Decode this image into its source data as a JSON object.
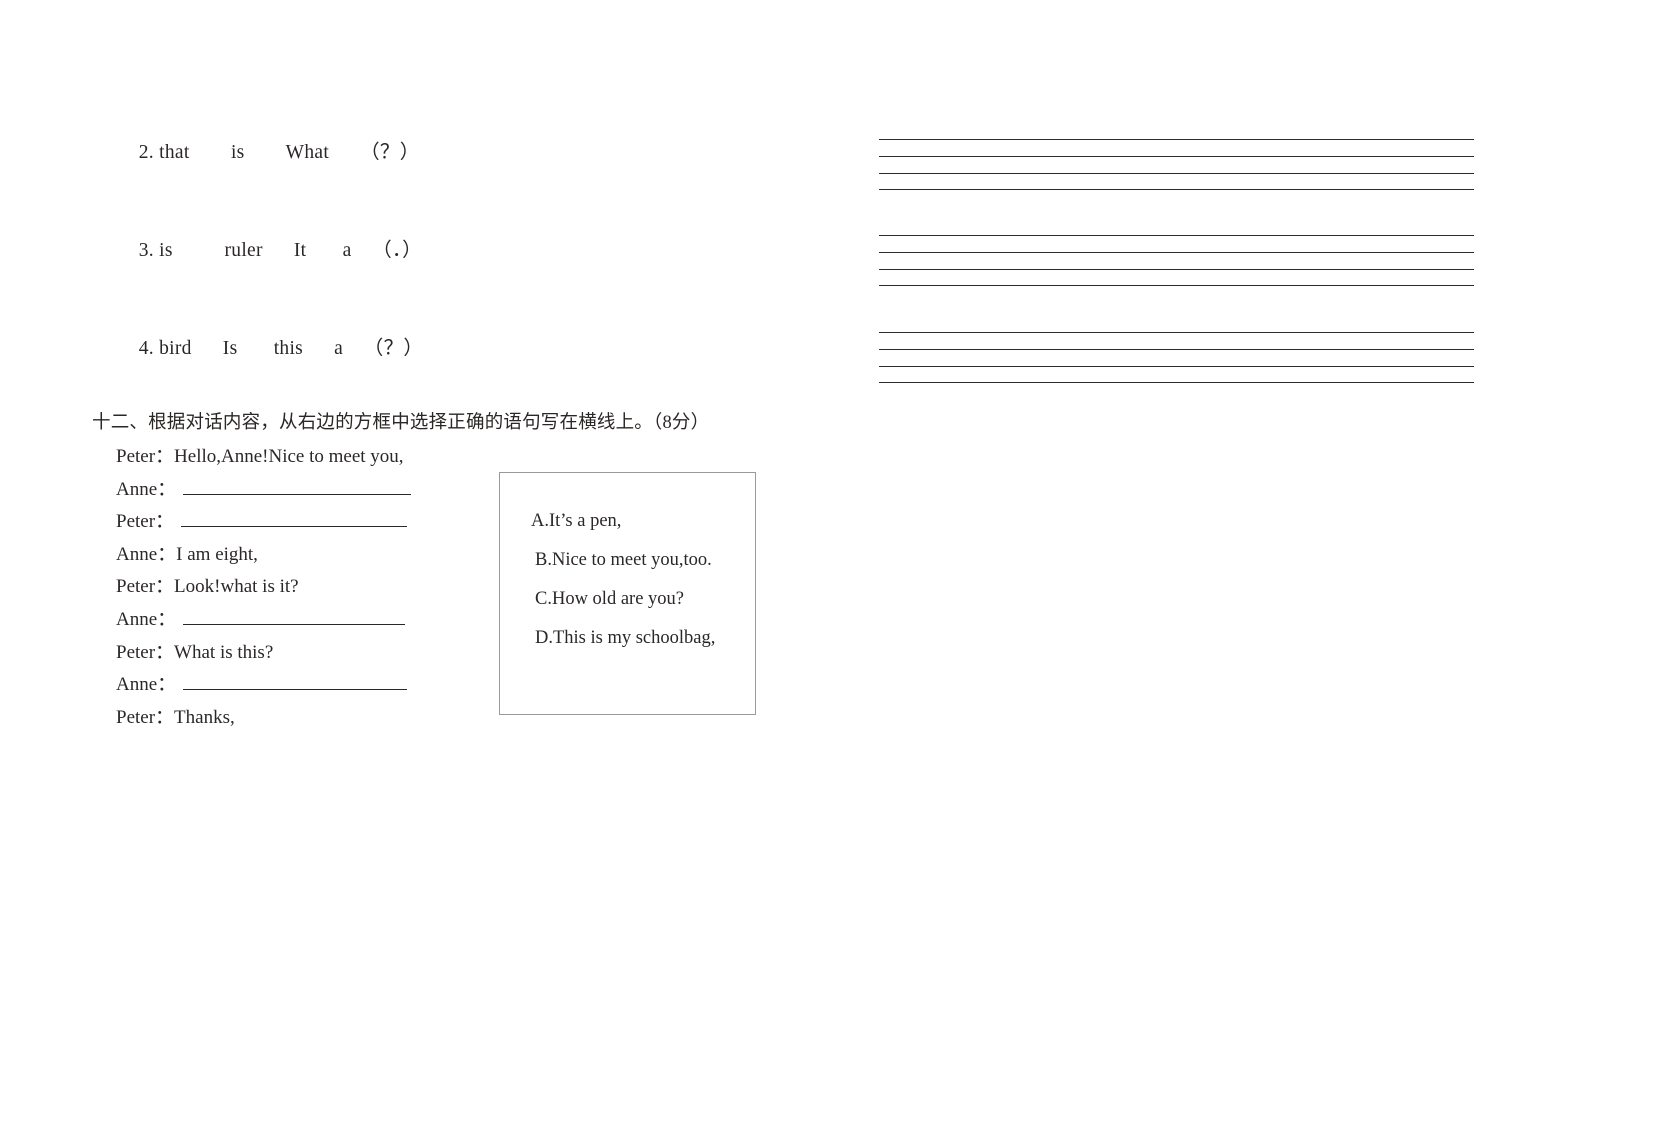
{
  "worksheet": {
    "scramble_exercises": [
      {
        "number": "2.",
        "words": "that        is        What      （？）"
      },
      {
        "number": "3.",
        "words": "is          ruler      It       a    （．）"
      },
      {
        "number": "4.",
        "words": "bird      Is       this      a    （？）"
      }
    ],
    "section": {
      "heading": "十二、根据对话内容，从右边的方框中选择正确的语句写在横线上。（8分）"
    },
    "dialogue": [
      {
        "speaker": "Peter：",
        "text": "Hello,Anne!Nice to meet you,",
        "blank": false
      },
      {
        "speaker": "Anne：",
        "text": "",
        "blank": true
      },
      {
        "speaker": "Peter：",
        "text": "",
        "blank": true
      },
      {
        "speaker": "Anne：",
        "text": "I am eight,",
        "blank": false
      },
      {
        "speaker": "Peter：",
        "text": "Look!what is it?",
        "blank": false
      },
      {
        "speaker": "Anne：",
        "text": "",
        "blank": true
      },
      {
        "speaker": "Peter：",
        "text": "What is this?",
        "blank": false
      },
      {
        "speaker": "Anne：",
        "text": "",
        "blank": true
      },
      {
        "speaker": "Peter：",
        "text": "Thanks,",
        "blank": false
      }
    ],
    "options": [
      "A.It’s a pen,",
      "B.Nice to meet you,too.",
      "C.How old are you?",
      "D.This is my schoolbag,"
    ],
    "writing_lines": {
      "group_count": 3,
      "lines_per_group": 4
    }
  }
}
